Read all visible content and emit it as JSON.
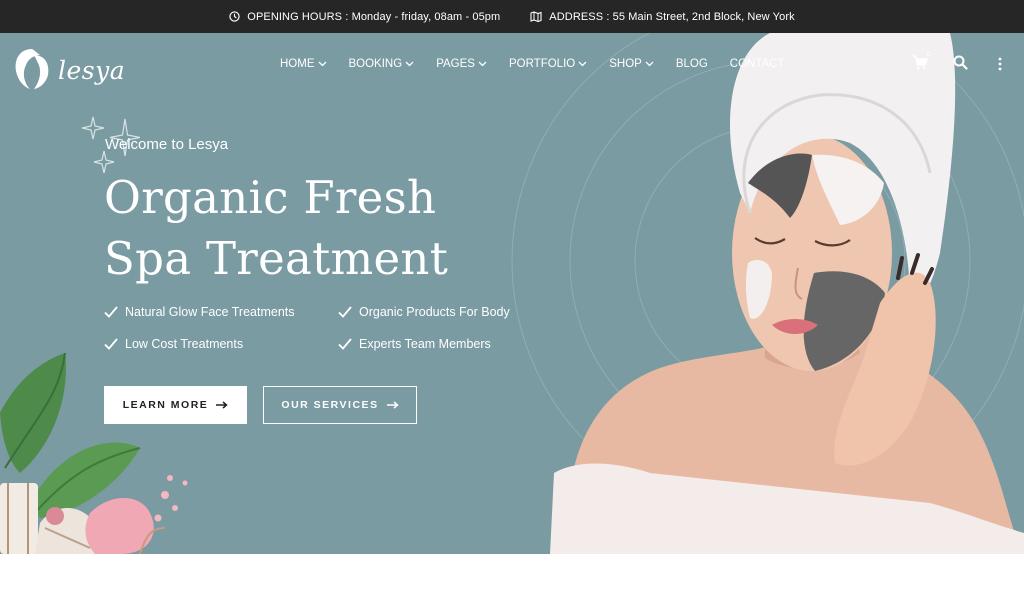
{
  "topbar": {
    "hours": "OPENING HOURS : Monday - friday, 08am - 05pm",
    "address": "ADDRESS : 55 Main Street, 2nd Block, New York"
  },
  "brand": {
    "name": "lesya"
  },
  "nav": {
    "items": [
      {
        "label": "HOME",
        "dropdown": true
      },
      {
        "label": "BOOKING",
        "dropdown": true
      },
      {
        "label": "PAGES",
        "dropdown": true
      },
      {
        "label": "PORTFOLIO",
        "dropdown": true
      },
      {
        "label": "SHOP",
        "dropdown": true
      },
      {
        "label": "BLOG",
        "dropdown": false
      },
      {
        "label": "CONTACT",
        "dropdown": false
      }
    ],
    "cart_count": "0"
  },
  "hero": {
    "welcome": "Welcome to Lesya",
    "heading_line1": "Organic Fresh",
    "heading_line2": "Spa Treatment",
    "features": [
      "Natural Glow Face Treatments",
      "Organic Products For Body",
      "Low Cost Treatments",
      "Experts Team Members"
    ],
    "primary_button": "LEARN MORE",
    "secondary_button": "OUR SERVICES"
  },
  "colors": {
    "hero_bg": "#7a9ba2",
    "topbar_bg": "#262626",
    "text": "#ffffff"
  },
  "icons": [
    "clock-icon",
    "map-icon",
    "logo-hair-icon",
    "chevron-down-icon",
    "cart-icon",
    "search-icon",
    "more-dots-icon",
    "check-icon",
    "arrow-right-icon",
    "sparkle-icon"
  ]
}
